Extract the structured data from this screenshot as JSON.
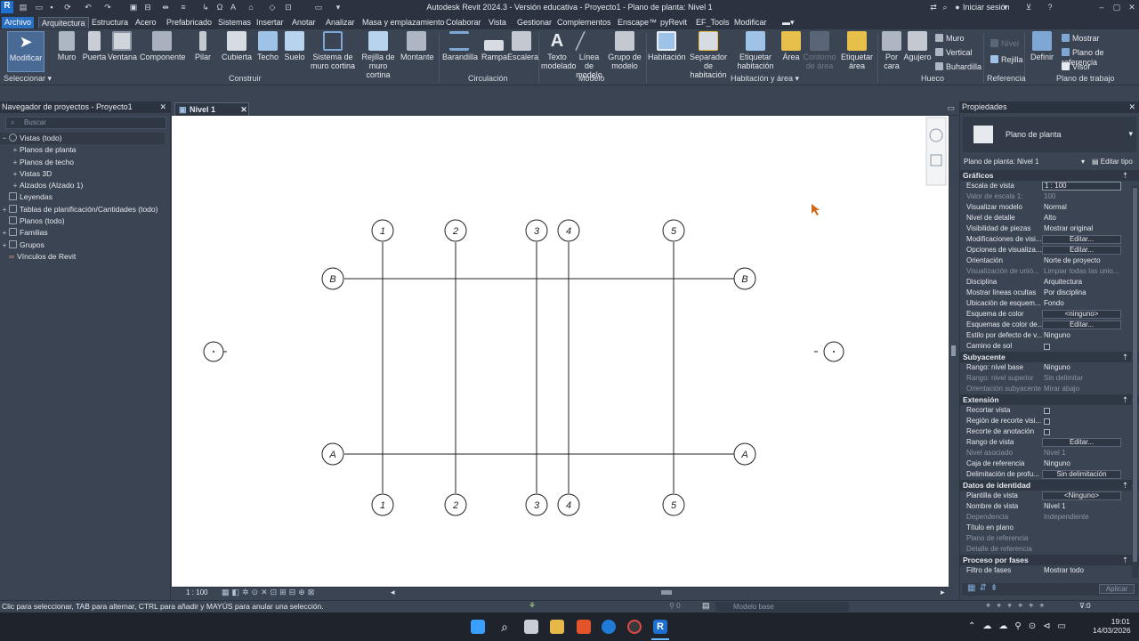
{
  "title": "Autodesk Revit 2024.3 - Versión educativa - Proyecto1 - Plano de planta: Nivel 1",
  "topright": {
    "signin": "Iniciar sesión"
  },
  "menu": [
    "Archivo",
    "Arquitectura",
    "Estructura",
    "Acero",
    "Prefabricado",
    "Sistemas",
    "Insertar",
    "Anotar",
    "Analizar",
    "Masa y emplazamiento",
    "Colaborar",
    "Vista",
    "Gestionar",
    "Complementos",
    "Enscape™",
    "pyRevit",
    "EF_Tools",
    "Modificar"
  ],
  "ribbon": {
    "tools": [
      {
        "l1": "Modificar",
        "l2": ""
      },
      {
        "l1": "Muro",
        "l2": ""
      },
      {
        "l1": "Puerta",
        "l2": ""
      },
      {
        "l1": "Ventana",
        "l2": ""
      },
      {
        "l1": "Componente",
        "l2": ""
      },
      {
        "l1": "Pilar",
        "l2": ""
      },
      {
        "l1": "Cubierta",
        "l2": ""
      },
      {
        "l1": "Techo",
        "l2": ""
      },
      {
        "l1": "Suelo",
        "l2": ""
      },
      {
        "l1": "Sistema de",
        "l2": "muro cortina"
      },
      {
        "l1": "Rejilla de",
        "l2": "muro cortina"
      },
      {
        "l1": "Montante",
        "l2": ""
      },
      {
        "l1": "Barandilla",
        "l2": ""
      },
      {
        "l1": "Rampa",
        "l2": ""
      },
      {
        "l1": "Escalera",
        "l2": ""
      },
      {
        "l1": "Texto",
        "l2": "modelado"
      },
      {
        "l1": "Línea de",
        "l2": "modelo"
      },
      {
        "l1": "Grupo de",
        "l2": "modelo"
      },
      {
        "l1": "Habitación",
        "l2": ""
      },
      {
        "l1": "Separador",
        "l2": "de habitación"
      },
      {
        "l1": "Etiquetar",
        "l2": "habitación"
      },
      {
        "l1": "Área",
        "l2": ""
      },
      {
        "l1": "Contorno",
        "l2": "de área"
      },
      {
        "l1": "Etiquetar",
        "l2": "área"
      },
      {
        "l1": "Por",
        "l2": "cara"
      },
      {
        "l1": "Agujero",
        "l2": ""
      },
      {
        "l1": "Definir",
        "l2": ""
      }
    ],
    "small": {
      "muro": "Muro",
      "vertical": "Vertical",
      "buhardilla": "Buhardilla",
      "nivel": "Nivel",
      "rejilla": "Rejilla",
      "mostrar": "Mostrar",
      "plano_ref": "Plano de referencia",
      "visor": "Visor"
    },
    "groups": [
      "Seleccionar",
      "Construir",
      "Circulación",
      "Modelo",
      "Habitación y área",
      "Hueco",
      "Referencia",
      "Plano de trabajo"
    ]
  },
  "browser": {
    "title": "Navegador de proyectos - Proyecto1",
    "search_placeholder": "Buscar",
    "items": [
      "Vistas (todo)",
      "Planos de planta",
      "Planos de techo",
      "Vistas 3D",
      "Alzados (Alzado 1)",
      "Leyendas",
      "Tablas de planificación/Cantidades (todo)",
      "Planos (todo)",
      "Familias",
      "Grupos",
      "Vínculos de Revit"
    ]
  },
  "doc_tab": "Nivel 1",
  "grid": {
    "vertical": [
      "1",
      "2",
      "3",
      "4",
      "5"
    ],
    "horizontal": [
      "B",
      "A"
    ]
  },
  "view_bar": {
    "scale": "1 : 100"
  },
  "properties": {
    "title": "Propiedades",
    "type": "Plano de planta",
    "selector": "Plano de planta: Nivel 1",
    "edit_type": "Editar tipo",
    "sections": [
      {
        "name": "Gráficos",
        "rows": [
          {
            "k": "Escala de vista",
            "v": "1 : 100",
            "kind": "field"
          },
          {
            "k": "Valor de escala    1:",
            "v": "100",
            "kind": "dis"
          },
          {
            "k": "Visualizar modelo",
            "v": "Normal",
            "kind": "text"
          },
          {
            "k": "Nivel de detalle",
            "v": "Alto",
            "kind": "text"
          },
          {
            "k": "Visibilidad de piezas",
            "v": "Mostrar original",
            "kind": "text"
          },
          {
            "k": "Modificaciones de visi...",
            "v": "Editar...",
            "kind": "btn"
          },
          {
            "k": "Opciones de visualiza...",
            "v": "Editar...",
            "kind": "btn"
          },
          {
            "k": "Orientación",
            "v": "Norte de proyecto",
            "kind": "text"
          },
          {
            "k": "Visualización de unió...",
            "v": "Limpiar todas las unio...",
            "kind": "dis"
          },
          {
            "k": "Disciplina",
            "v": "Arquitectura",
            "kind": "text"
          },
          {
            "k": "Mostrar líneas ocultas",
            "v": "Por disciplina",
            "kind": "text"
          },
          {
            "k": "Ubicación de esquem...",
            "v": "Fondo",
            "kind": "text"
          },
          {
            "k": "Esquema de color",
            "v": "<ninguno>",
            "kind": "btn"
          },
          {
            "k": "Esquemas de color de...",
            "v": "Editar...",
            "kind": "btn"
          },
          {
            "k": "Estilo por defecto de v...",
            "v": "Ninguno",
            "kind": "text"
          },
          {
            "k": "Camino de sol",
            "v": "",
            "kind": "check"
          }
        ]
      },
      {
        "name": "Subyacente",
        "rows": [
          {
            "k": "Rango: nivel base",
            "v": "Ninguno",
            "kind": "text"
          },
          {
            "k": "Rango: nivel superior",
            "v": "Sin delimitar",
            "kind": "dis"
          },
          {
            "k": "Orientación subyacente",
            "v": "Mirar abajo",
            "kind": "dis"
          }
        ]
      },
      {
        "name": "Extensión",
        "rows": [
          {
            "k": "Recortar vista",
            "v": "",
            "kind": "check"
          },
          {
            "k": "Región de recorte visi...",
            "v": "",
            "kind": "check"
          },
          {
            "k": "Recorte de anotación",
            "v": "",
            "kind": "check"
          },
          {
            "k": "Rango de vista",
            "v": "Editar...",
            "kind": "btn"
          },
          {
            "k": "Nivel asociado",
            "v": "Nivel 1",
            "kind": "dis"
          },
          {
            "k": "Caja de referencia",
            "v": "Ninguno",
            "kind": "text"
          },
          {
            "k": "Delimitación de profu...",
            "v": "Sin delimitación",
            "kind": "btn"
          }
        ]
      },
      {
        "name": "Datos de identidad",
        "rows": [
          {
            "k": "Plantilla de vista",
            "v": "<Ninguno>",
            "kind": "btn"
          },
          {
            "k": "Nombre de vista",
            "v": "Nivel 1",
            "kind": "text"
          },
          {
            "k": "Dependencia",
            "v": "Independiente",
            "kind": "dis"
          },
          {
            "k": "Título en plano",
            "v": "",
            "kind": "text"
          },
          {
            "k": "Plano de referencia",
            "v": "",
            "kind": "dis"
          },
          {
            "k": "Detalle de referencia",
            "v": "",
            "kind": "dis"
          }
        ]
      },
      {
        "name": "Proceso por fases",
        "rows": [
          {
            "k": "Filtro de fases",
            "v": "Mostrar todo",
            "kind": "text"
          }
        ]
      }
    ],
    "apply": "Aplicar"
  },
  "status": {
    "message": "Clic para seleccionar, TAB para alternar, CTRL para añadir y MAYÚS para anular una selección.",
    "model": "Modelo base",
    "zero1": "0",
    "zero2": ":0"
  },
  "clock": {
    "time": "19:01",
    "date": "14/03/2026"
  }
}
